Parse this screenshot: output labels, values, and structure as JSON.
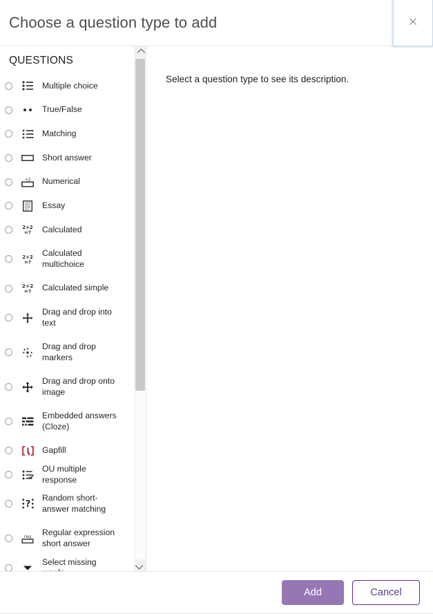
{
  "header": {
    "title": "Choose a question type to add",
    "close_label": "×"
  },
  "left_pane": {
    "heading": "QUESTIONS",
    "items": [
      {
        "label": "Multiple choice",
        "icon": "multiple-choice-icon"
      },
      {
        "label": "True/False",
        "icon": "true-false-icon"
      },
      {
        "label": "Matching",
        "icon": "matching-icon"
      },
      {
        "label": "Short answer",
        "icon": "short-answer-icon"
      },
      {
        "label": "Numerical",
        "icon": "numerical-icon"
      },
      {
        "label": "Essay",
        "icon": "essay-icon"
      },
      {
        "label": "Calculated",
        "icon": "calculated-icon"
      },
      {
        "label": "Calculated multichoice",
        "icon": "calculated-multichoice-icon"
      },
      {
        "label": "Calculated simple",
        "icon": "calculated-simple-icon"
      },
      {
        "label": "Drag and drop into text",
        "icon": "drag-drop-text-icon"
      },
      {
        "label": "Drag and drop markers",
        "icon": "drag-drop-markers-icon"
      },
      {
        "label": "Drag and drop onto image",
        "icon": "drag-drop-image-icon"
      },
      {
        "label": "Embedded answers (Cloze)",
        "icon": "embedded-answers-icon"
      },
      {
        "label": "Gapfill",
        "icon": "gapfill-icon"
      },
      {
        "label": "OU multiple response",
        "icon": "ou-multiple-response-icon"
      },
      {
        "label": "Random short-answer matching",
        "icon": "random-short-answer-icon"
      },
      {
        "label": "Regular expression short answer",
        "icon": "regex-short-answer-icon"
      },
      {
        "label": "Select missing words",
        "icon": "select-missing-words-icon"
      }
    ]
  },
  "right_pane": {
    "description": "Select a question type to see its description."
  },
  "footer": {
    "add_label": "Add",
    "cancel_label": "Cancel"
  },
  "colors": {
    "accent_purple": "#8e6cae",
    "cancel_border": "#5b2d8e",
    "focus_ring": "#bcd9f2",
    "scrollbar_thumb": "#c9c9c9"
  }
}
